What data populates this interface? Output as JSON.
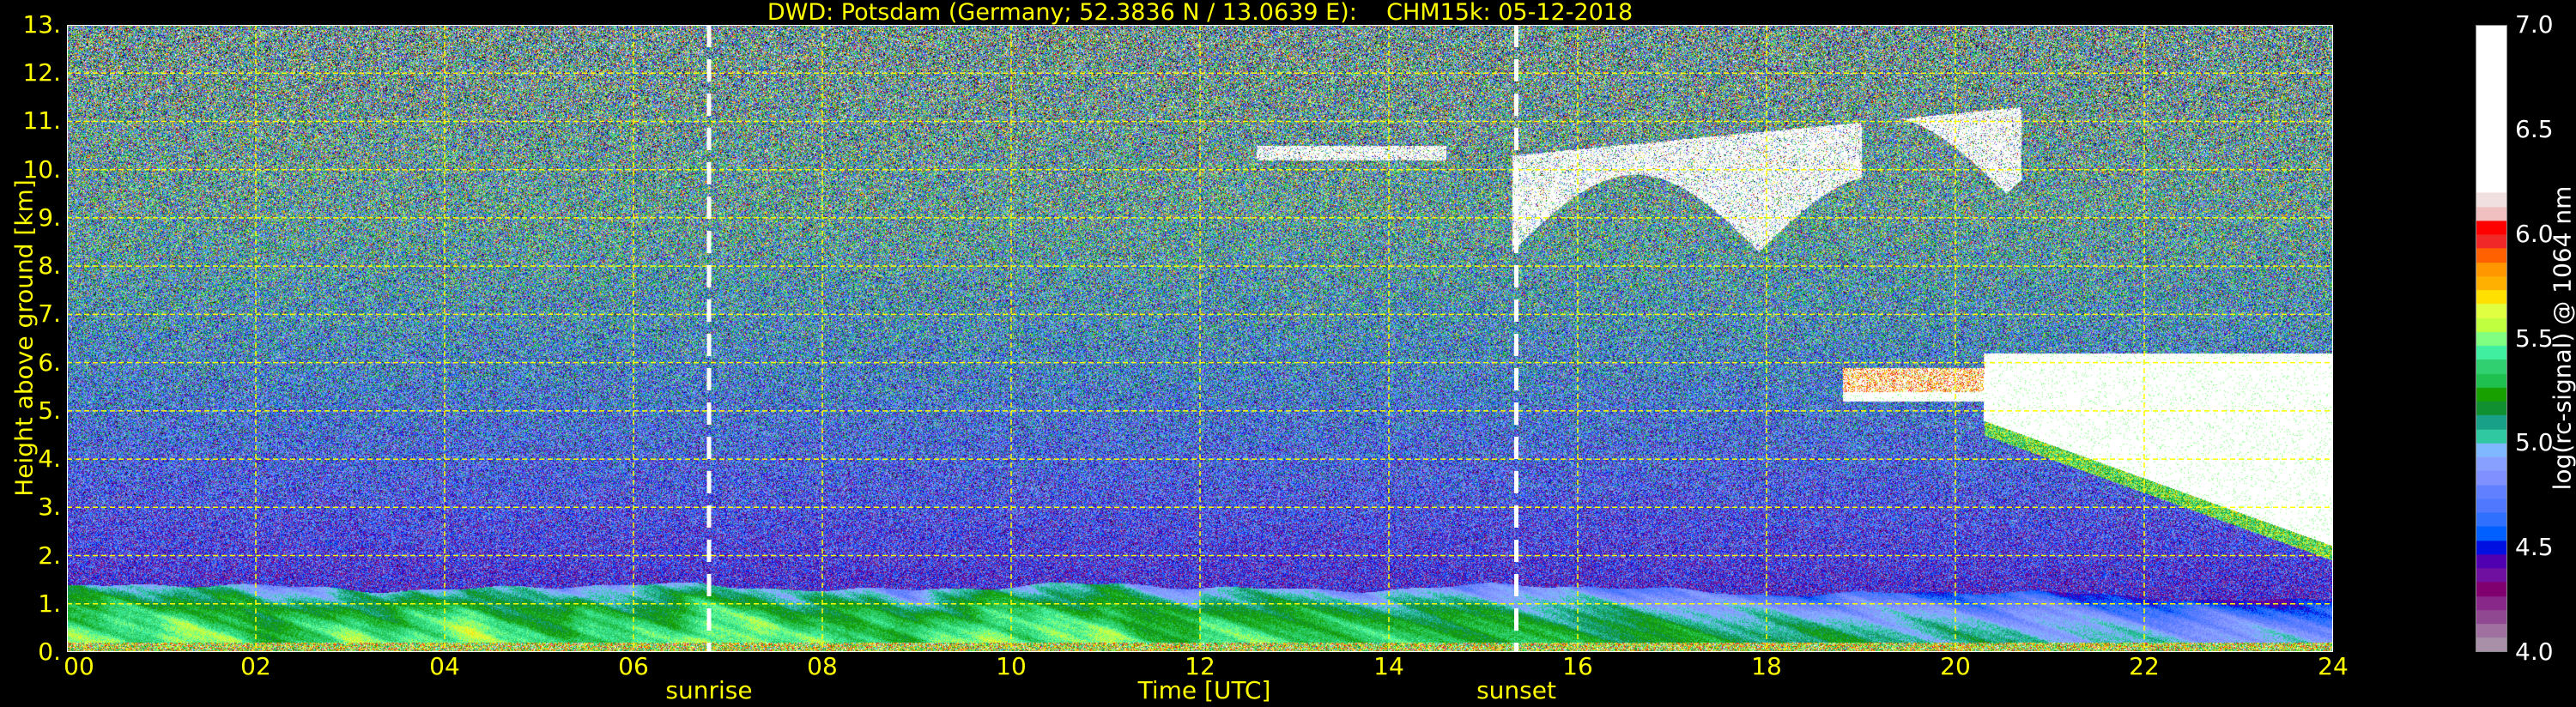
{
  "chart_data": {
    "type": "heatmap",
    "title": "DWD: Potsdam (Germany; 52.3836 N / 13.0639 E):    CHM15k: 05-12-2018",
    "xlabel": "Time [UTC]",
    "ylabel": "Height above ground [km]",
    "xlim": [
      0,
      24
    ],
    "ylim": [
      0,
      13
    ],
    "x_ticks": [
      "00",
      "02",
      "04",
      "06",
      "08",
      "10",
      "12",
      "14",
      "16",
      "18",
      "20",
      "22",
      "24"
    ],
    "y_ticks": [
      "0.",
      "1.",
      "2.",
      "3.",
      "4.",
      "5.",
      "6.",
      "7.",
      "8.",
      "9.",
      "10.",
      "11.",
      "12.",
      "13."
    ],
    "grid": true,
    "grid_color": "#ffff00",
    "events": [
      {
        "label": "sunrise",
        "time_utc": 6.8
      },
      {
        "label": "sunset",
        "time_utc": 15.35
      }
    ],
    "colorbar": {
      "label": "log(rc-signal) @ 1064 nm",
      "range": [
        4.0,
        7.0
      ],
      "ticks": [
        "4.0",
        "4.5",
        "5.0",
        "5.5",
        "6.0",
        "6.5",
        "7.0"
      ],
      "colors": [
        "#a890a8",
        "#a070a0",
        "#904890",
        "#882888",
        "#800070",
        "#7010a0",
        "#5000b0",
        "#0010e0",
        "#0060ff",
        "#3070ff",
        "#5078ff",
        "#6080ff",
        "#8090ff",
        "#88a0ff",
        "#80b8ff",
        "#30c8a0",
        "#18a088",
        "#109030",
        "#18a000",
        "#20c050",
        "#30d070",
        "#40f0a0",
        "#80ff80",
        "#c0ff40",
        "#e0ff40",
        "#ffe000",
        "#ffb000",
        "#ff9800",
        "#ff6000",
        "#f02828",
        "#ff0000",
        "#f0c0c0",
        "#f0e0e0",
        "#ffffff"
      ]
    },
    "features": [
      {
        "kind": "boundary layer aerosol",
        "time_utc": [
          0,
          24
        ],
        "height_km": [
          0,
          1.4
        ],
        "log_signal_approx": [
          4.8,
          5.7
        ]
      },
      {
        "kind": "cirrus cloud",
        "time_utc": [
          12.6,
          20.7
        ],
        "height_km": [
          7.8,
          11.2
        ],
        "log_signal_approx": [
          6.0,
          7.0
        ]
      },
      {
        "kind": "mid-level cloud",
        "time_utc": [
          18.8,
          24
        ],
        "height_km": [
          2.2,
          6.3
        ],
        "log_signal_approx": [
          6.0,
          7.0
        ]
      }
    ]
  }
}
